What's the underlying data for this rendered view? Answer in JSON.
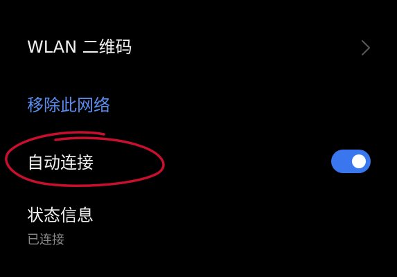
{
  "settings": {
    "wlan_qr_label": "WLAN 二维码",
    "remove_network_label": "移除此网络",
    "auto_connect_label": "自动连接",
    "auto_connect_enabled": true,
    "status_label": "状态信息",
    "status_value": "已连接"
  },
  "colors": {
    "background": "#000000",
    "text": "#f2f2f2",
    "link": "#5b8dee",
    "toggle_on": "#3a77ef",
    "annotation": "#c8102e"
  },
  "icons": {
    "chevron": "chevron-right-icon"
  }
}
